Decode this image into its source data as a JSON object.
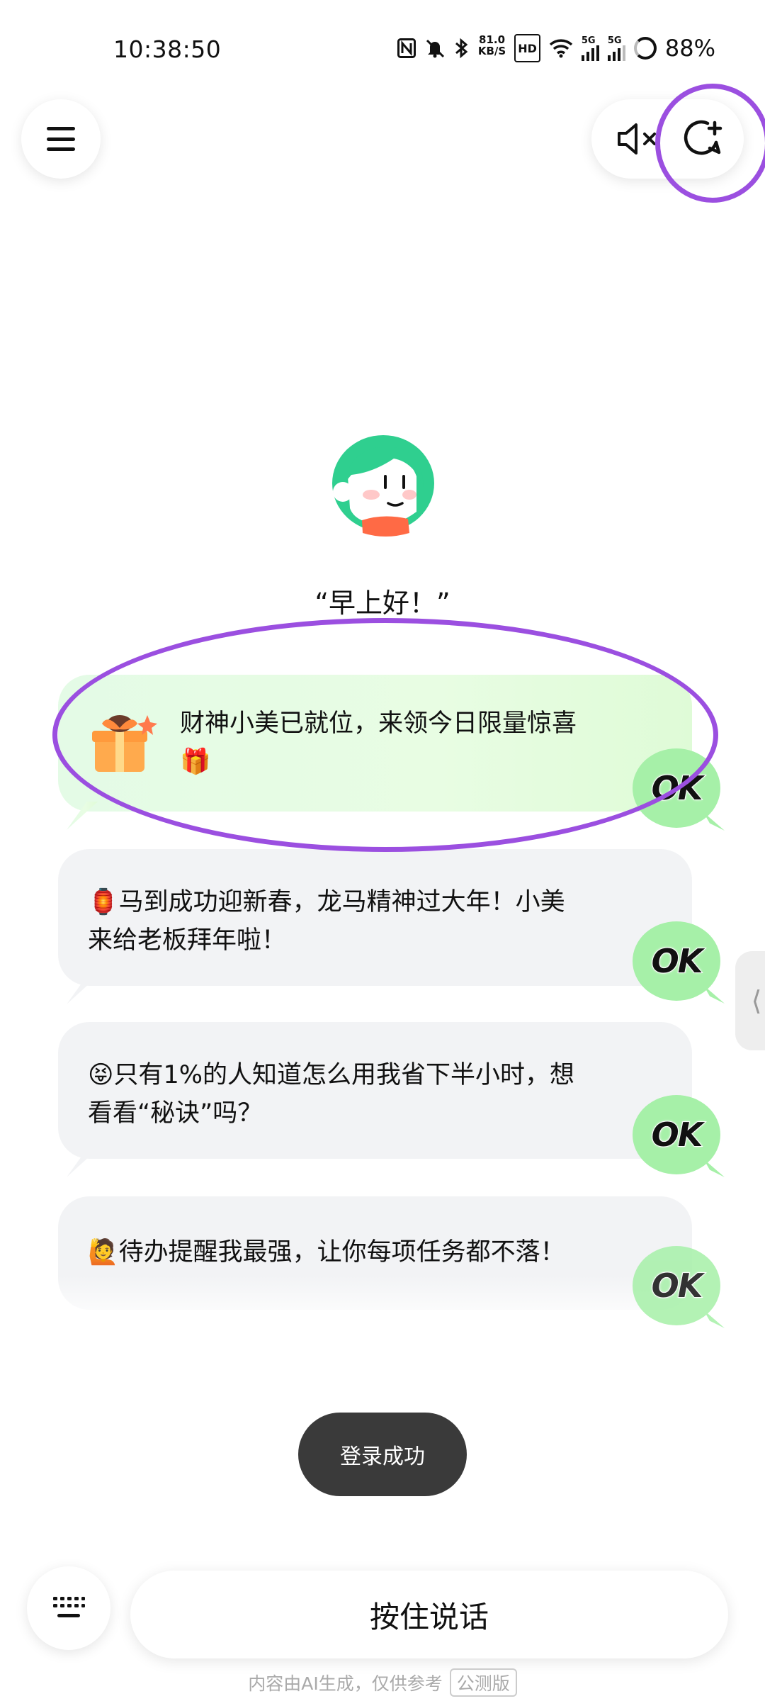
{
  "status_bar": {
    "time": "10:38:50",
    "speed_value": "81.0",
    "speed_unit": "KB/S",
    "hd_label": "HD",
    "network_1": "5G",
    "network_2": "5G",
    "battery": "88%"
  },
  "greeting": "“早上好！”",
  "suggestions": [
    {
      "text": "财神小美已就位，来领今日限量惊喜🎁",
      "ok": "OK"
    },
    {
      "text": "🏮马到成功迎新春，龙马精神过大年！小美来给老板拜年啦！",
      "ok": "OK"
    },
    {
      "text": "😝只有1%的人知道怎么用我省下半小时，想看看“秘诀”吗？",
      "ok": "OK"
    },
    {
      "text": "🙋待办提醒我最强，让你每项任务都不落！",
      "ok": "OK"
    }
  ],
  "side_tab_glyph": "⟨",
  "toast": "登录成功",
  "talk_button": "按住说话",
  "disclaimer": "内容由AI生成，仅供参考",
  "beta_tag": "公测版",
  "colors": {
    "highlight": "#9b4fe0",
    "ok_green": "#a6f0a8",
    "card_gray": "#f2f3f5",
    "card_green": "#e4fbe6",
    "toast_bg": "#3a3a3a"
  }
}
